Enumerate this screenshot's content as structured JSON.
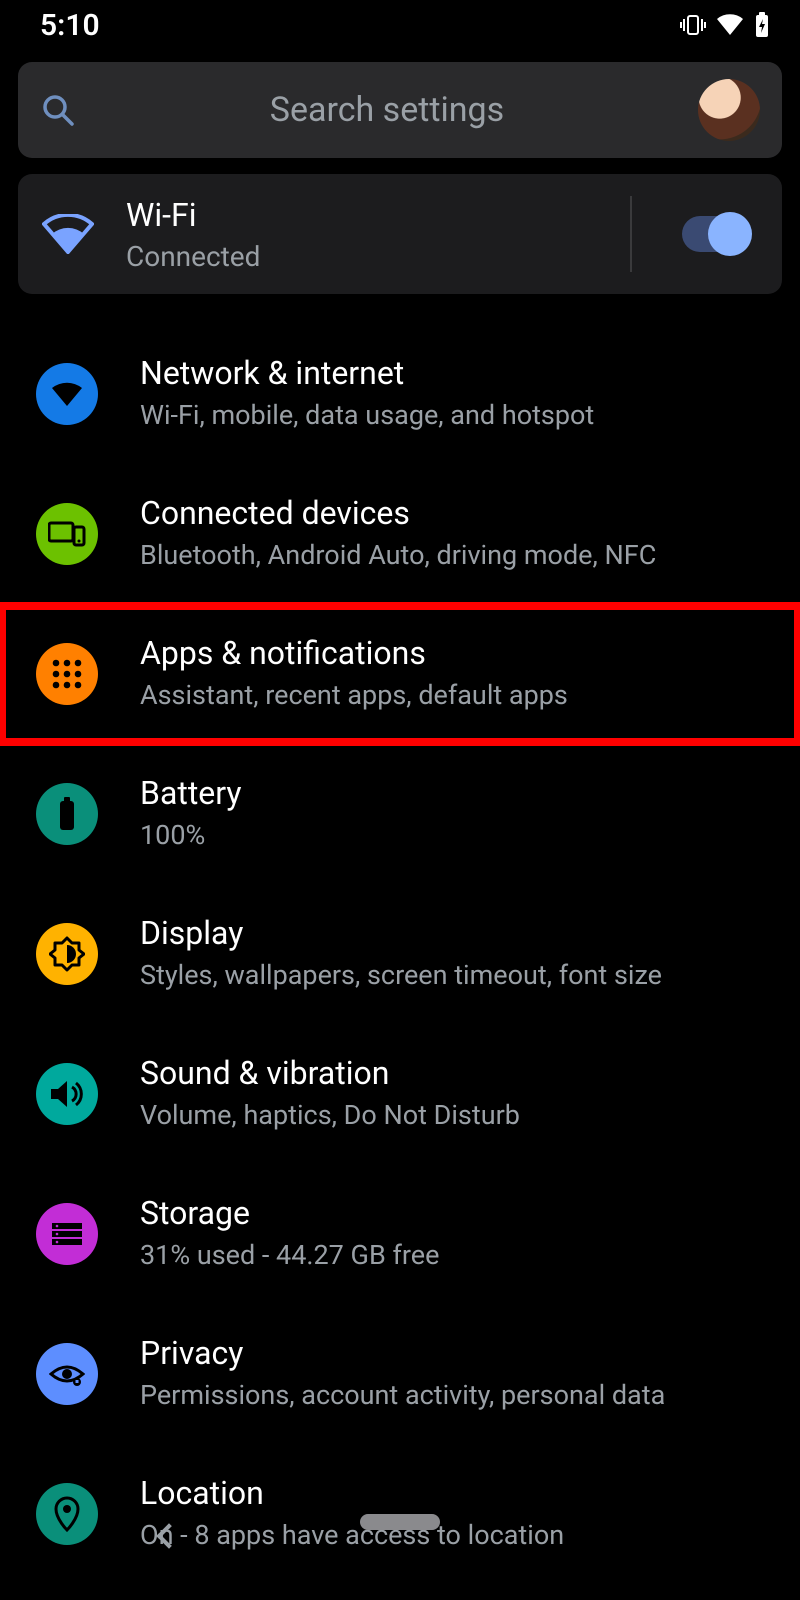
{
  "status": {
    "time": "5:10"
  },
  "search": {
    "placeholder": "Search settings"
  },
  "wifi_card": {
    "title": "Wi-Fi",
    "subtitle": "Connected",
    "enabled": true
  },
  "highlighted_item_id": "apps",
  "settings": [
    {
      "id": "network",
      "title": "Network & internet",
      "subtitle": "Wi-Fi, mobile, data usage, and hotspot",
      "icon": "wifi",
      "color": "bg-blue"
    },
    {
      "id": "devices",
      "title": "Connected devices",
      "subtitle": "Bluetooth, Android Auto, driving mode, NFC",
      "icon": "devices",
      "color": "bg-green"
    },
    {
      "id": "apps",
      "title": "Apps & notifications",
      "subtitle": "Assistant, recent apps, default apps",
      "icon": "apps",
      "color": "bg-orange"
    },
    {
      "id": "battery",
      "title": "Battery",
      "subtitle": "100%",
      "icon": "battery",
      "color": "bg-teal"
    },
    {
      "id": "display",
      "title": "Display",
      "subtitle": "Styles, wallpapers, screen timeout, font size",
      "icon": "brightness",
      "color": "bg-yellow"
    },
    {
      "id": "sound",
      "title": "Sound & vibration",
      "subtitle": "Volume, haptics, Do Not Disturb",
      "icon": "volume",
      "color": "bg-cyan"
    },
    {
      "id": "storage",
      "title": "Storage",
      "subtitle": "31% used - 44.27 GB free",
      "icon": "storage",
      "color": "bg-magenta"
    },
    {
      "id": "privacy",
      "title": "Privacy",
      "subtitle": "Permissions, account activity, personal data",
      "icon": "privacy",
      "color": "bg-lblue"
    },
    {
      "id": "location",
      "title": "Location",
      "subtitle": "On - 8 apps have access to location",
      "icon": "location",
      "color": "bg-teal2"
    }
  ]
}
